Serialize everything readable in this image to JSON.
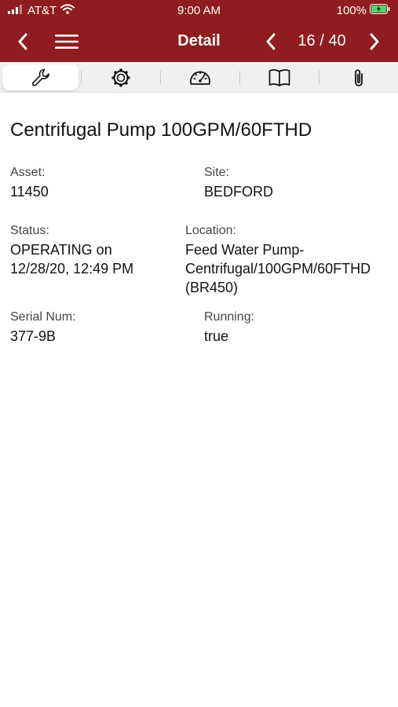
{
  "status_bar": {
    "carrier": "AT&T",
    "time": "9:00 AM",
    "battery": "100%"
  },
  "nav": {
    "title": "Detail",
    "counter": "16 / 40"
  },
  "tabs": [
    {
      "icon": "wrench-icon",
      "active": true
    },
    {
      "icon": "gear-icon",
      "active": false
    },
    {
      "icon": "gauge-icon",
      "active": false
    },
    {
      "icon": "book-icon",
      "active": false
    },
    {
      "icon": "paperclip-icon",
      "active": false
    }
  ],
  "detail": {
    "title": "Centrifugal Pump 100GPM/60FTHD",
    "asset_label": "Asset:",
    "asset_value": "11450",
    "site_label": "Site:",
    "site_value": "BEDFORD",
    "status_label": "Status:",
    "status_line1": "OPERATING on",
    "status_line2": "12/28/20, 12:49 PM",
    "location_label": "Location:",
    "location_line1": "Feed Water Pump-",
    "location_line2": "Centrifugal/100GPM/60FTHD",
    "location_line3": "(BR450)",
    "serial_label": "Serial Num:",
    "serial_value": "377-9B",
    "running_label": "Running:",
    "running_value": "true"
  },
  "colors": {
    "header": "#8f1c1e",
    "battery": "#4cd964"
  }
}
